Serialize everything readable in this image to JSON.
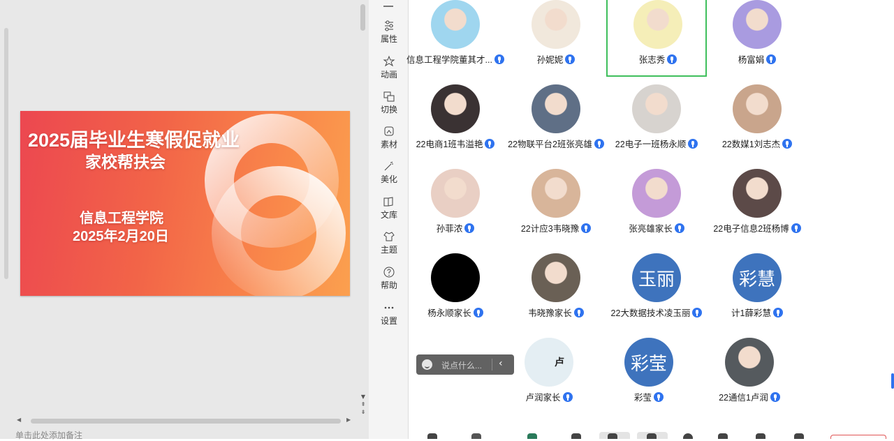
{
  "slide": {
    "title_line1": "2025届毕业生寒假促就业",
    "title_line2": "家校帮扶会",
    "subtitle_line1": "信息工程学院",
    "subtitle_line2": "2025年2月20日"
  },
  "notes_placeholder": "单击此处添加备注",
  "toolbar": {
    "items": [
      {
        "label": "属性",
        "icon": "properties-icon"
      },
      {
        "label": "动画",
        "icon": "star-icon"
      },
      {
        "label": "切换",
        "icon": "transition-icon"
      },
      {
        "label": "素材",
        "icon": "material-icon"
      },
      {
        "label": "美化",
        "icon": "magic-wand-icon"
      },
      {
        "label": "文库",
        "icon": "library-icon"
      },
      {
        "label": "主题",
        "icon": "theme-icon"
      },
      {
        "label": "帮助",
        "icon": "help-icon"
      },
      {
        "label": "设置",
        "icon": "more-icon"
      }
    ]
  },
  "participants": [
    {
      "name": "信息工程学院董其才...",
      "avatar": "cartoon-boy",
      "color": "#9fd6ef"
    },
    {
      "name": "孙妮妮",
      "avatar": "nezha-cartoon",
      "color": "#f1e8dc"
    },
    {
      "name": "张志秀",
      "avatar": "doraemon",
      "color": "#f5eeb8",
      "active": true
    },
    {
      "name": "杨富娟",
      "avatar": "bear-cartoon",
      "color": "#a99be0"
    },
    {
      "name": "22电商1班韦溢艳",
      "avatar": "photo-man",
      "color": "#3a3233"
    },
    {
      "name": "22物联平台2班张亮雄",
      "avatar": "cat-art",
      "color": "#5f6f86"
    },
    {
      "name": "22电子一班杨永顺",
      "avatar": "sketch-drink",
      "color": "#d7d3cf"
    },
    {
      "name": "22数媒1刘志杰",
      "avatar": "photo-man2",
      "color": "#c9a58c"
    },
    {
      "name": "孙菲浓",
      "avatar": "photo-girl",
      "color": "#e9cfc4"
    },
    {
      "name": "22计应3韦晓豫",
      "avatar": "photo-boy",
      "color": "#d8b59a"
    },
    {
      "name": "张亮雄家长",
      "avatar": "anime-girl",
      "color": "#c49bd8"
    },
    {
      "name": "22电子信息2班杨博",
      "avatar": "anime-dark",
      "color": "#5c4a48"
    },
    {
      "name": "杨永顺家长",
      "avatar": "black",
      "color": "#000000"
    },
    {
      "name": "韦晓豫家长",
      "avatar": "city-night",
      "color": "#6a6055"
    },
    {
      "name": "22大数据技术凌玉丽",
      "avatar": "initials",
      "initials": "玉丽",
      "color": "#3e73bd"
    },
    {
      "name": "计1薛彩慧",
      "avatar": "initials",
      "initials": "彩慧",
      "color": "#3e73bd"
    },
    {
      "name": "卢润家长",
      "avatar": "panda-card",
      "color": "#e4eef3",
      "mark": "卢"
    },
    {
      "name": "彩莹",
      "avatar": "initials",
      "initials": "彩莹",
      "color": "#3e73bd"
    },
    {
      "name": "22通信1卢润",
      "avatar": "city-person",
      "color": "#555a5e"
    }
  ],
  "chat": {
    "placeholder": "说点什么..."
  },
  "colors": {
    "active_border": "#3fbf5c",
    "mic_blue": "#2f73ef",
    "initials_bg": "#3e73bd"
  }
}
